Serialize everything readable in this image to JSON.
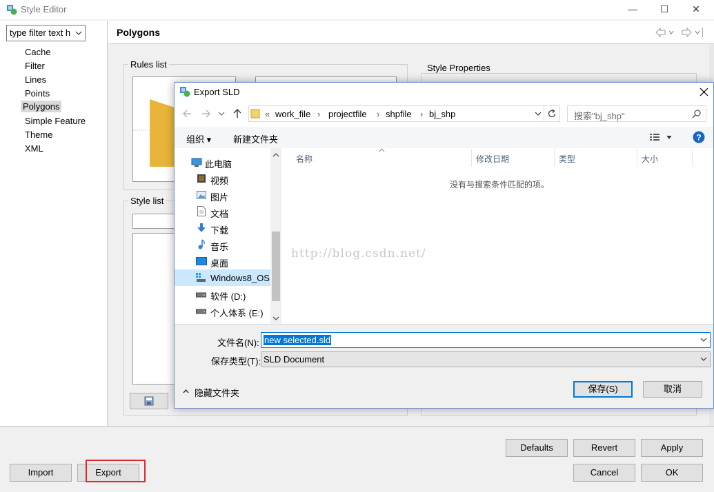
{
  "window": {
    "title": "Style Editor",
    "minimize": "—",
    "maximize": "☐",
    "close": "✕"
  },
  "sidebar": {
    "filter_value": "type filter text h",
    "items": [
      {
        "label": "Cache",
        "selected": false
      },
      {
        "label": "Filter",
        "selected": false
      },
      {
        "label": "Lines",
        "selected": false
      },
      {
        "label": "Points",
        "selected": false
      },
      {
        "label": "Polygons",
        "selected": true
      },
      {
        "label": "Simple Feature",
        "selected": false
      },
      {
        "label": "Theme",
        "selected": false
      },
      {
        "label": "XML",
        "selected": false
      }
    ]
  },
  "header": {
    "title": "Polygons"
  },
  "editor": {
    "rules_list_label": "Rules list",
    "style_list_label": "Style list",
    "style_properties_label": "Style Properties"
  },
  "footer": {
    "import_label": "Import",
    "export_label": "Export",
    "defaults_label": "Defaults",
    "revert_label": "Revert",
    "apply_label": "Apply",
    "cancel_label": "Cancel",
    "ok_label": "OK"
  },
  "dialog": {
    "title": "Export SLD",
    "breadcrumb": [
      "work_file",
      "projectfile",
      "shpfile",
      "bj_shp"
    ],
    "breadcrumb_prefix": "«",
    "search_placeholder": "搜索\"bj_shp\"",
    "organize_label": "组织 ▾",
    "new_folder_label": "新建文件夹",
    "nav_items": [
      {
        "label": "此电脑",
        "icon": "computer-icon"
      },
      {
        "label": "视频",
        "icon": "video-icon"
      },
      {
        "label": "图片",
        "icon": "pictures-icon"
      },
      {
        "label": "文档",
        "icon": "documents-icon"
      },
      {
        "label": "下载",
        "icon": "download-icon"
      },
      {
        "label": "音乐",
        "icon": "music-icon"
      },
      {
        "label": "桌面",
        "icon": "desktop-icon"
      },
      {
        "label": "Windows8_OS",
        "icon": "drive-c-icon"
      },
      {
        "label": "软件 (D:)",
        "icon": "drive-d-icon"
      },
      {
        "label": "个人体系 (E:)",
        "icon": "drive-e-icon"
      }
    ],
    "columns": [
      "名称",
      "修改日期",
      "类型",
      "大小"
    ],
    "empty_message": "没有与搜索条件匹配的项。",
    "watermark": "http://blog.csdn.net/",
    "filename_label": "文件名(N):",
    "filename_value": "new selected.sld",
    "filetype_label": "保存类型(T):",
    "filetype_value": "SLD Document",
    "hide_folders_label": "隐藏文件夹",
    "save_label": "保存(S)",
    "cancel_label": "取消"
  },
  "colors": {
    "accent": "#0078d7",
    "highlight_box": "#e0282e",
    "polygon_fill": "#e8b53a"
  }
}
